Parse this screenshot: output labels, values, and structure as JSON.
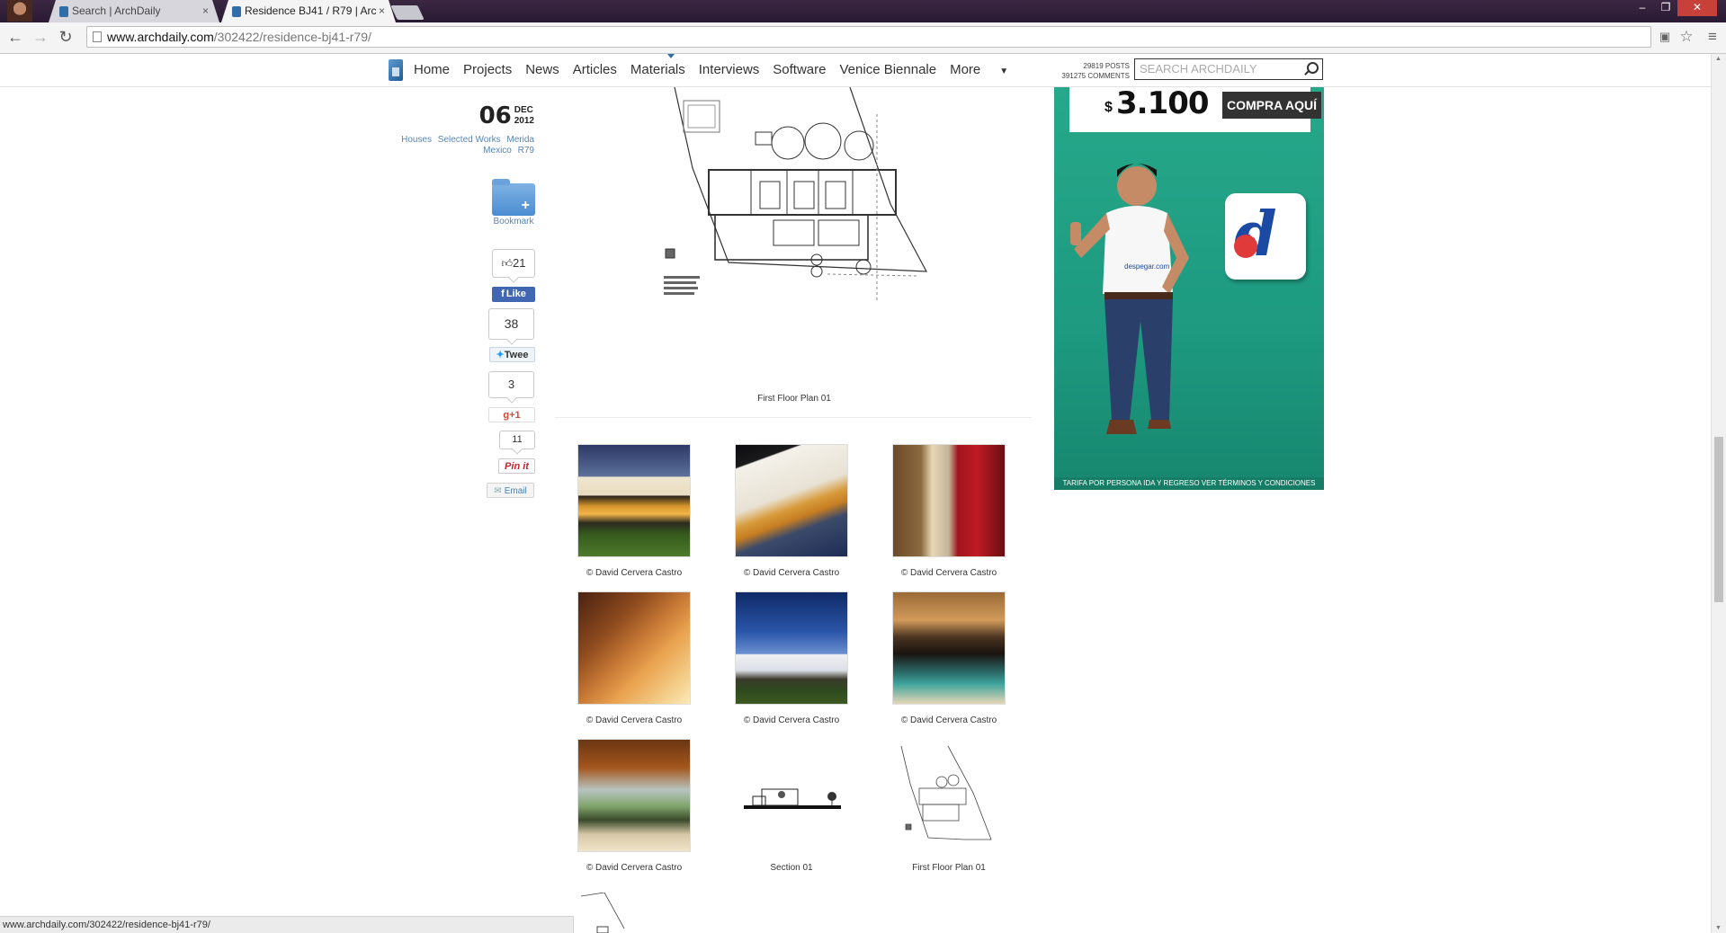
{
  "browser": {
    "tabs": [
      {
        "title": "Search | ArchDaily",
        "active": false
      },
      {
        "title": "Residence BJ41 / R79 | Arc",
        "active": true
      }
    ],
    "tab_close_glyph": "×",
    "url_host": "www.archdaily.com",
    "url_path": "/302422/residence-bj41-r79/",
    "status_text": "www.archdaily.com/302422/residence-bj41-r79/",
    "icons": [
      "back-icon",
      "forward-icon",
      "reload-icon",
      "page-icon",
      "translate-icon",
      "star-icon",
      "menu-icon"
    ]
  },
  "site_nav": {
    "links": [
      "Home",
      "Projects",
      "News",
      "Articles",
      "Materials",
      "Interviews",
      "Software",
      "Venice Biennale",
      "More"
    ],
    "more_caret": "▼",
    "posts_count": "29819 POSTS",
    "comments_count": "391275 COMMENTS",
    "search_placeholder": "SEARCH ARCHDAILY"
  },
  "article_meta": {
    "day": "06",
    "month": "DEC",
    "year": "2012",
    "tags": [
      "Houses",
      "Selected Works",
      "Merida",
      "Mexico",
      "R79"
    ],
    "bookmark_label": "Bookmark",
    "bookmark_plus": "+"
  },
  "share": {
    "likes_count": "21",
    "fb_like_label": "Like",
    "tweets_count": "38",
    "tweet_label": "Twee",
    "gplus_count": "3",
    "gplus_label": "g+1",
    "pins_count": "11",
    "pin_label": "Pin it",
    "email_label": "Email"
  },
  "main": {
    "plan_caption": "First Floor Plan 01",
    "gallery": [
      {
        "caption": "© David Cervera Castro",
        "kind": "photo"
      },
      {
        "caption": "© David Cervera Castro",
        "kind": "photo"
      },
      {
        "caption": "© David Cervera Castro",
        "kind": "photo"
      },
      {
        "caption": "© David Cervera Castro",
        "kind": "photo"
      },
      {
        "caption": "© David Cervera Castro",
        "kind": "photo"
      },
      {
        "caption": "© David Cervera Castro",
        "kind": "photo"
      },
      {
        "caption": "© David Cervera Castro",
        "kind": "photo"
      },
      {
        "caption": "Section 01",
        "kind": "drawing"
      },
      {
        "caption": "First Floor Plan 01",
        "kind": "drawing"
      }
    ]
  },
  "ad": {
    "currency": "$",
    "price": "3.100",
    "cta": "COMPRA AQUÍ",
    "fine_print": "TARIFA POR PERSONA IDA Y REGRESO VER TÉRMINOS Y CONDICIONES",
    "brand_shirt": "despegar.com",
    "logo_letter": "d",
    "accent_color": "#1d9a80"
  }
}
